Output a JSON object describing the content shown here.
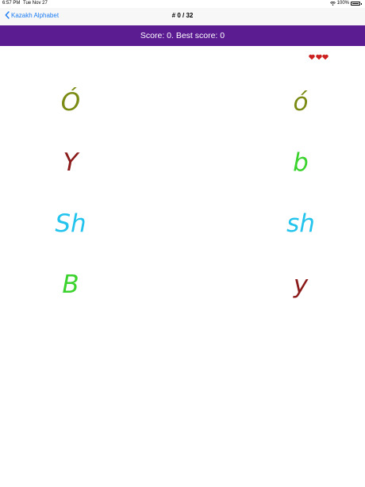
{
  "status_bar": {
    "time": "6:57 PM",
    "date": "Tue Nov 27",
    "battery": "100%"
  },
  "nav": {
    "back_label": "Kazakh Alphabet",
    "title": "# 0 / 32"
  },
  "score": {
    "text": "Score: 0. Best score: 0"
  },
  "lives": {
    "count": 3,
    "icon": "heart-icon",
    "color": "#cc1f1f"
  },
  "letters": {
    "left": [
      {
        "text": "Ó",
        "color": "#7a8a12"
      },
      {
        "text": "Y",
        "color": "#8b1a1a"
      },
      {
        "text": "Sh",
        "color": "#22c4ee"
      },
      {
        "text": "B",
        "color": "#3ad22c"
      }
    ],
    "right": [
      {
        "text": "ó",
        "color": "#7a8a12"
      },
      {
        "text": "b",
        "color": "#3ad22c"
      },
      {
        "text": "sh",
        "color": "#22c4ee"
      },
      {
        "text": "y",
        "color": "#8b1a1a"
      }
    ]
  }
}
